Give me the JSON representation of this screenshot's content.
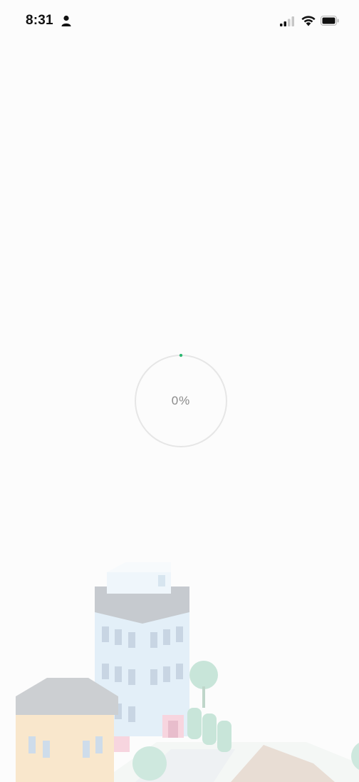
{
  "status_bar": {
    "time": "8:31",
    "icons": [
      "person-icon",
      "signal-icon",
      "wifi-icon",
      "battery-icon"
    ]
  },
  "loader": {
    "percent_text": "0%",
    "progress_percent": 0,
    "ring_color": "#e6e6e6",
    "accent_color": "#2eb872"
  },
  "illustration": {
    "name": "city-buildings"
  }
}
